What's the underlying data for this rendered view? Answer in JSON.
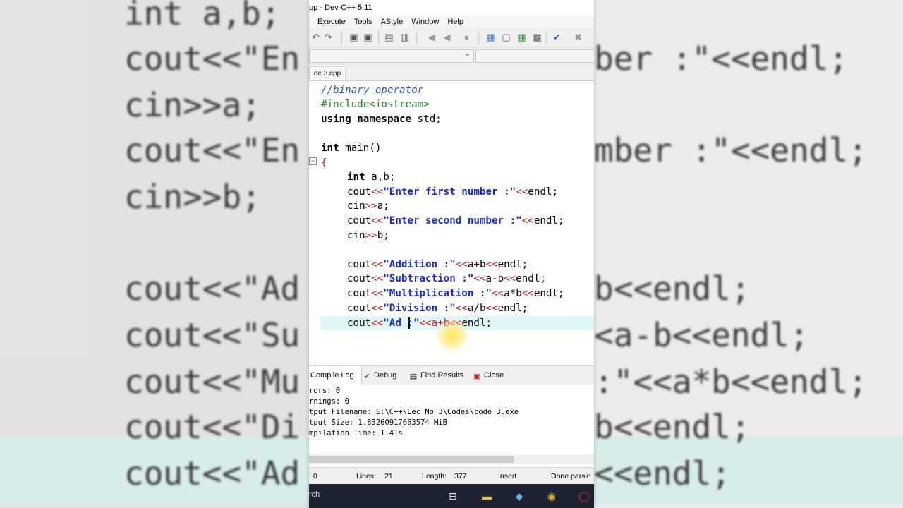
{
  "window": {
    "title": "pp - Dev-C++ 5.11"
  },
  "menu": [
    "Execute",
    "Tools",
    "AStyle",
    "Window",
    "Help"
  ],
  "file_tab": "de 3.cpp",
  "code": {
    "l1": "//binary operator",
    "l2": "#include<iostream>",
    "l3_kw": "using namespace",
    "l3_rest": " std;",
    "l5_kw": "int",
    "l5_rest": " main()",
    "l6": "{",
    "l7_kw": "int",
    "l7_rest": " a,b;",
    "l8_a": "cout",
    "l8_b": "<<",
    "l8_s": "\"Enter first number :\"",
    "l8_c": "<<",
    "l8_d": "endl;",
    "l9_a": "cin",
    "l9_b": ">>",
    "l9_c": "a;",
    "l10_s": "\"Enter second number :\"",
    "l11_c": "b;",
    "l13_s": "\"Addition :\"",
    "l13_e": "a+b",
    "l14_s": "\"Subtraction :\"",
    "l14_e": "a-b",
    "l15_s": "\"Multiplication :\"",
    "l15_e": "a*b",
    "l16_s": "\"Division :\"",
    "l16_e": "a/b",
    "l17_s1": "\"Ad",
    "l17_s2": " :\"",
    "l17_e": "a+b"
  },
  "bottom_tabs": {
    "compile_log": "Compile Log",
    "debug": "Debug",
    "find_results": "Find Results",
    "close": "Close"
  },
  "log": [
    "rors: 0",
    "rnings: 0",
    "tput Filename: E:\\C++\\Lec No 3\\Codes\\code 3.exe",
    "tput Size: 1.83260917663574 MiB",
    "mpilation Time: 1.41s"
  ],
  "status": {
    "col": ": 0",
    "lines_label": "Lines:",
    "lines": "21",
    "length_label": "Length:",
    "length": "377",
    "mode": "Insert",
    "state": "Done parsin"
  },
  "taskbar": {
    "search": "rch"
  },
  "background": {
    "lines": [
      "int a,b;",
      "cout<<\"En",
      "cin>>a;",
      "cout<<\"En",
      "cin>>b;",
      "cout<<\"Ad",
      "cout<<\"Su",
      "cout<<\"Mu",
      "cout<<\"Di",
      "cout<<\"Ad"
    ],
    "right": [
      "ber :\"<<endl;",
      "mber :\"<<endl;",
      "b<<endl;",
      "<a-b<<endl;",
      ":\"<<a*b<<endl;",
      "b<<endl;",
      "<<endl;"
    ]
  }
}
